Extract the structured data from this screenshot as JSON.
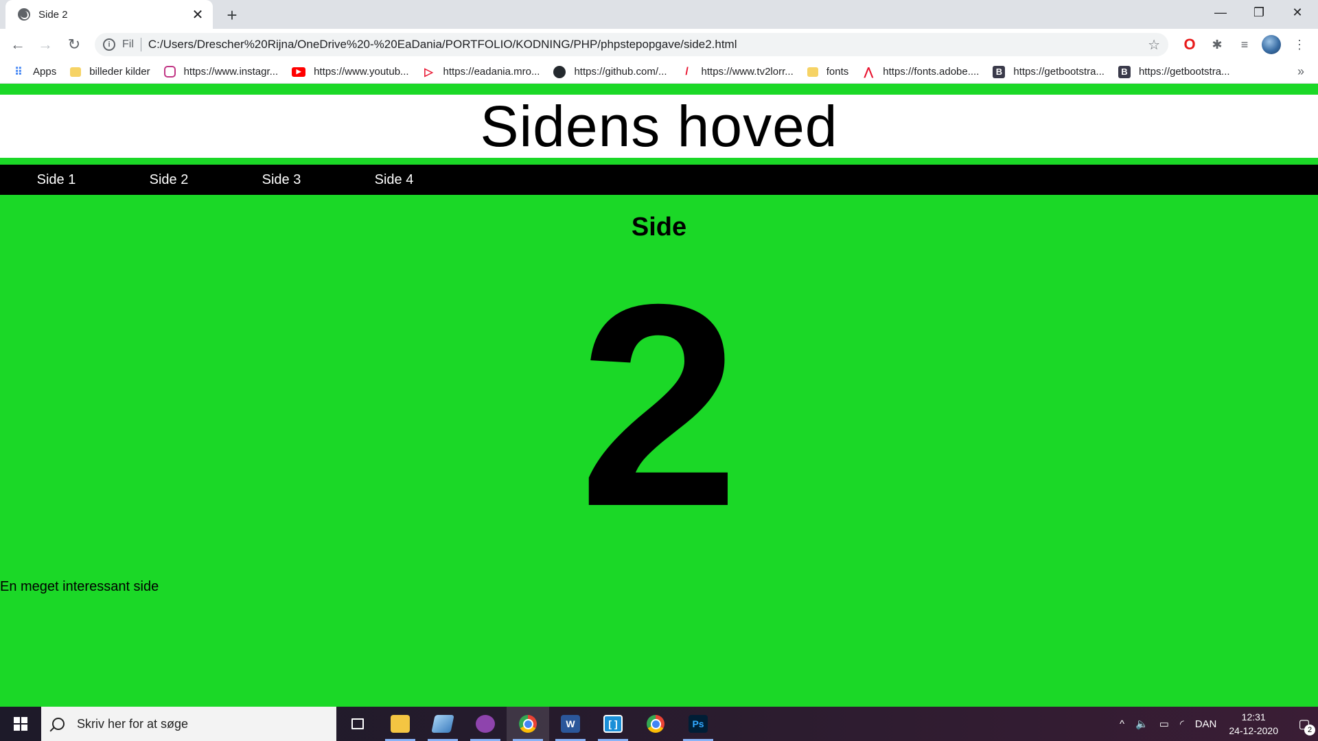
{
  "browser": {
    "tab_title": "Side 2",
    "tab_close": "✕",
    "new_tab": "+",
    "scheme_label": "Fil",
    "url": "C:/Users/Drescher%20Rijna/OneDrive%20-%20EaDania/PORTFOLIO/KODNING/PHP/phpstepopgave/side2.html",
    "bookmarks": [
      {
        "label": "Apps",
        "icon": "apps-grid-icon"
      },
      {
        "label": "billeder kilder",
        "icon": "folder-icon"
      },
      {
        "label": "https://www.instagr...",
        "icon": "instagram-icon"
      },
      {
        "label": "https://www.youtub...",
        "icon": "youtube-icon"
      },
      {
        "label": "https://eadania.mro...",
        "icon": "mro-icon"
      },
      {
        "label": "https://github.com/...",
        "icon": "github-icon"
      },
      {
        "label": "https://www.tv2lorr...",
        "icon": "tv2-icon"
      },
      {
        "label": "fonts",
        "icon": "folder-icon"
      },
      {
        "label": "https://fonts.adobe....",
        "icon": "adobe-icon"
      },
      {
        "label": "https://getbootstra...",
        "icon": "bootstrap-icon"
      },
      {
        "label": "https://getbootstra...",
        "icon": "bootstrap-icon"
      }
    ],
    "more_bookmarks": "»"
  },
  "page": {
    "header_title": "Sidens hoved",
    "nav": [
      "Side 1",
      "Side 2",
      "Side 3",
      "Side 4"
    ],
    "title": "Side",
    "number": "2",
    "text": "En meget interessant side",
    "background_color": "#1bd827"
  },
  "taskbar": {
    "search_placeholder": "Skriv her for at søge",
    "language": "DAN",
    "time": "12:31",
    "date": "24-12-2020",
    "notification_count": "2"
  }
}
